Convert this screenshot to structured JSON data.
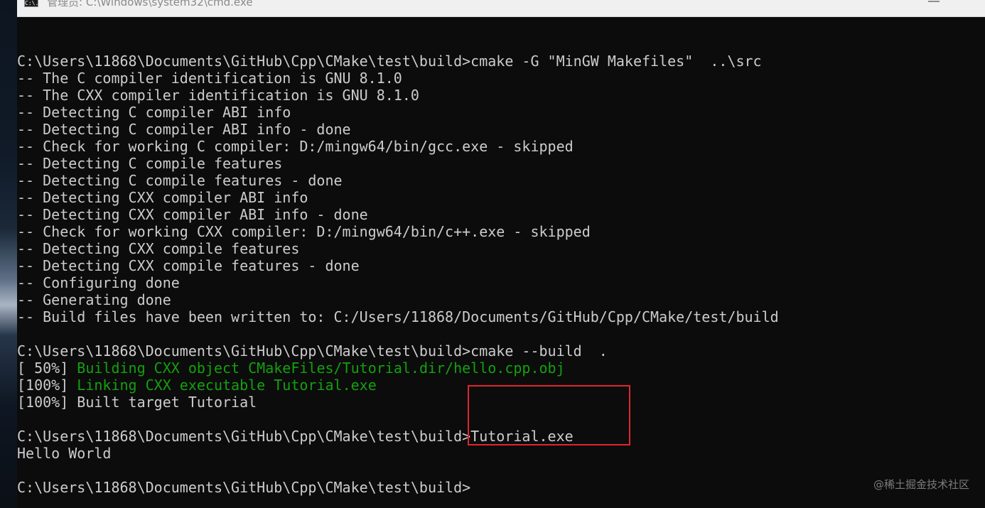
{
  "window": {
    "icon_text": "C:\\.",
    "title": "管理员: C:\\Windows\\system32\\cmd.exe"
  },
  "terminal": {
    "lines": [
      {
        "text": "",
        "style": "normal"
      },
      {
        "text": "C:\\Users\\11868\\Documents\\GitHub\\Cpp\\CMake\\test\\build>cmake -G \"MinGW Makefiles\"  ..\\src",
        "style": "normal"
      },
      {
        "text": "-- The C compiler identification is GNU 8.1.0",
        "style": "normal"
      },
      {
        "text": "-- The CXX compiler identification is GNU 8.1.0",
        "style": "normal"
      },
      {
        "text": "-- Detecting C compiler ABI info",
        "style": "normal"
      },
      {
        "text": "-- Detecting C compiler ABI info - done",
        "style": "normal"
      },
      {
        "text": "-- Check for working C compiler: D:/mingw64/bin/gcc.exe - skipped",
        "style": "normal"
      },
      {
        "text": "-- Detecting C compile features",
        "style": "normal"
      },
      {
        "text": "-- Detecting C compile features - done",
        "style": "normal"
      },
      {
        "text": "-- Detecting CXX compiler ABI info",
        "style": "normal"
      },
      {
        "text": "-- Detecting CXX compiler ABI info - done",
        "style": "normal"
      },
      {
        "text": "-- Check for working CXX compiler: D:/mingw64/bin/c++.exe - skipped",
        "style": "normal"
      },
      {
        "text": "-- Detecting CXX compile features",
        "style": "normal"
      },
      {
        "text": "-- Detecting CXX compile features - done",
        "style": "normal"
      },
      {
        "text": "-- Configuring done",
        "style": "normal"
      },
      {
        "text": "-- Generating done",
        "style": "normal"
      },
      {
        "text": "-- Build files have been written to: C:/Users/11868/Documents/GitHub/Cpp/CMake/test/build",
        "style": "normal"
      },
      {
        "text": "",
        "style": "normal"
      },
      {
        "text": "C:\\Users\\11868\\Documents\\GitHub\\Cpp\\CMake\\test\\build>cmake --build  .",
        "style": "normal"
      },
      {
        "prefix": "[ 50%] ",
        "text": "Building CXX object CMakeFiles/Tutorial.dir/hello.cpp.obj",
        "style": "green"
      },
      {
        "prefix": "[100%] ",
        "text": "Linking CXX executable Tutorial.exe",
        "style": "green"
      },
      {
        "text": "[100%] Built target Tutorial",
        "style": "normal"
      },
      {
        "text": "",
        "style": "normal"
      },
      {
        "text": "C:\\Users\\11868\\Documents\\GitHub\\Cpp\\CMake\\test\\build>Tutorial.exe",
        "style": "normal"
      },
      {
        "text": "Hello World",
        "style": "normal"
      },
      {
        "text": "",
        "style": "normal"
      },
      {
        "text": "C:\\Users\\11868\\Documents\\GitHub\\Cpp\\CMake\\test\\build>",
        "style": "normal"
      }
    ]
  },
  "watermark": "@稀土掘金技术社区",
  "colors": {
    "background": "#0c0c0c",
    "text": "#cccccc",
    "progress_text": "#13a10e",
    "highlight_box": "#e0262c"
  }
}
